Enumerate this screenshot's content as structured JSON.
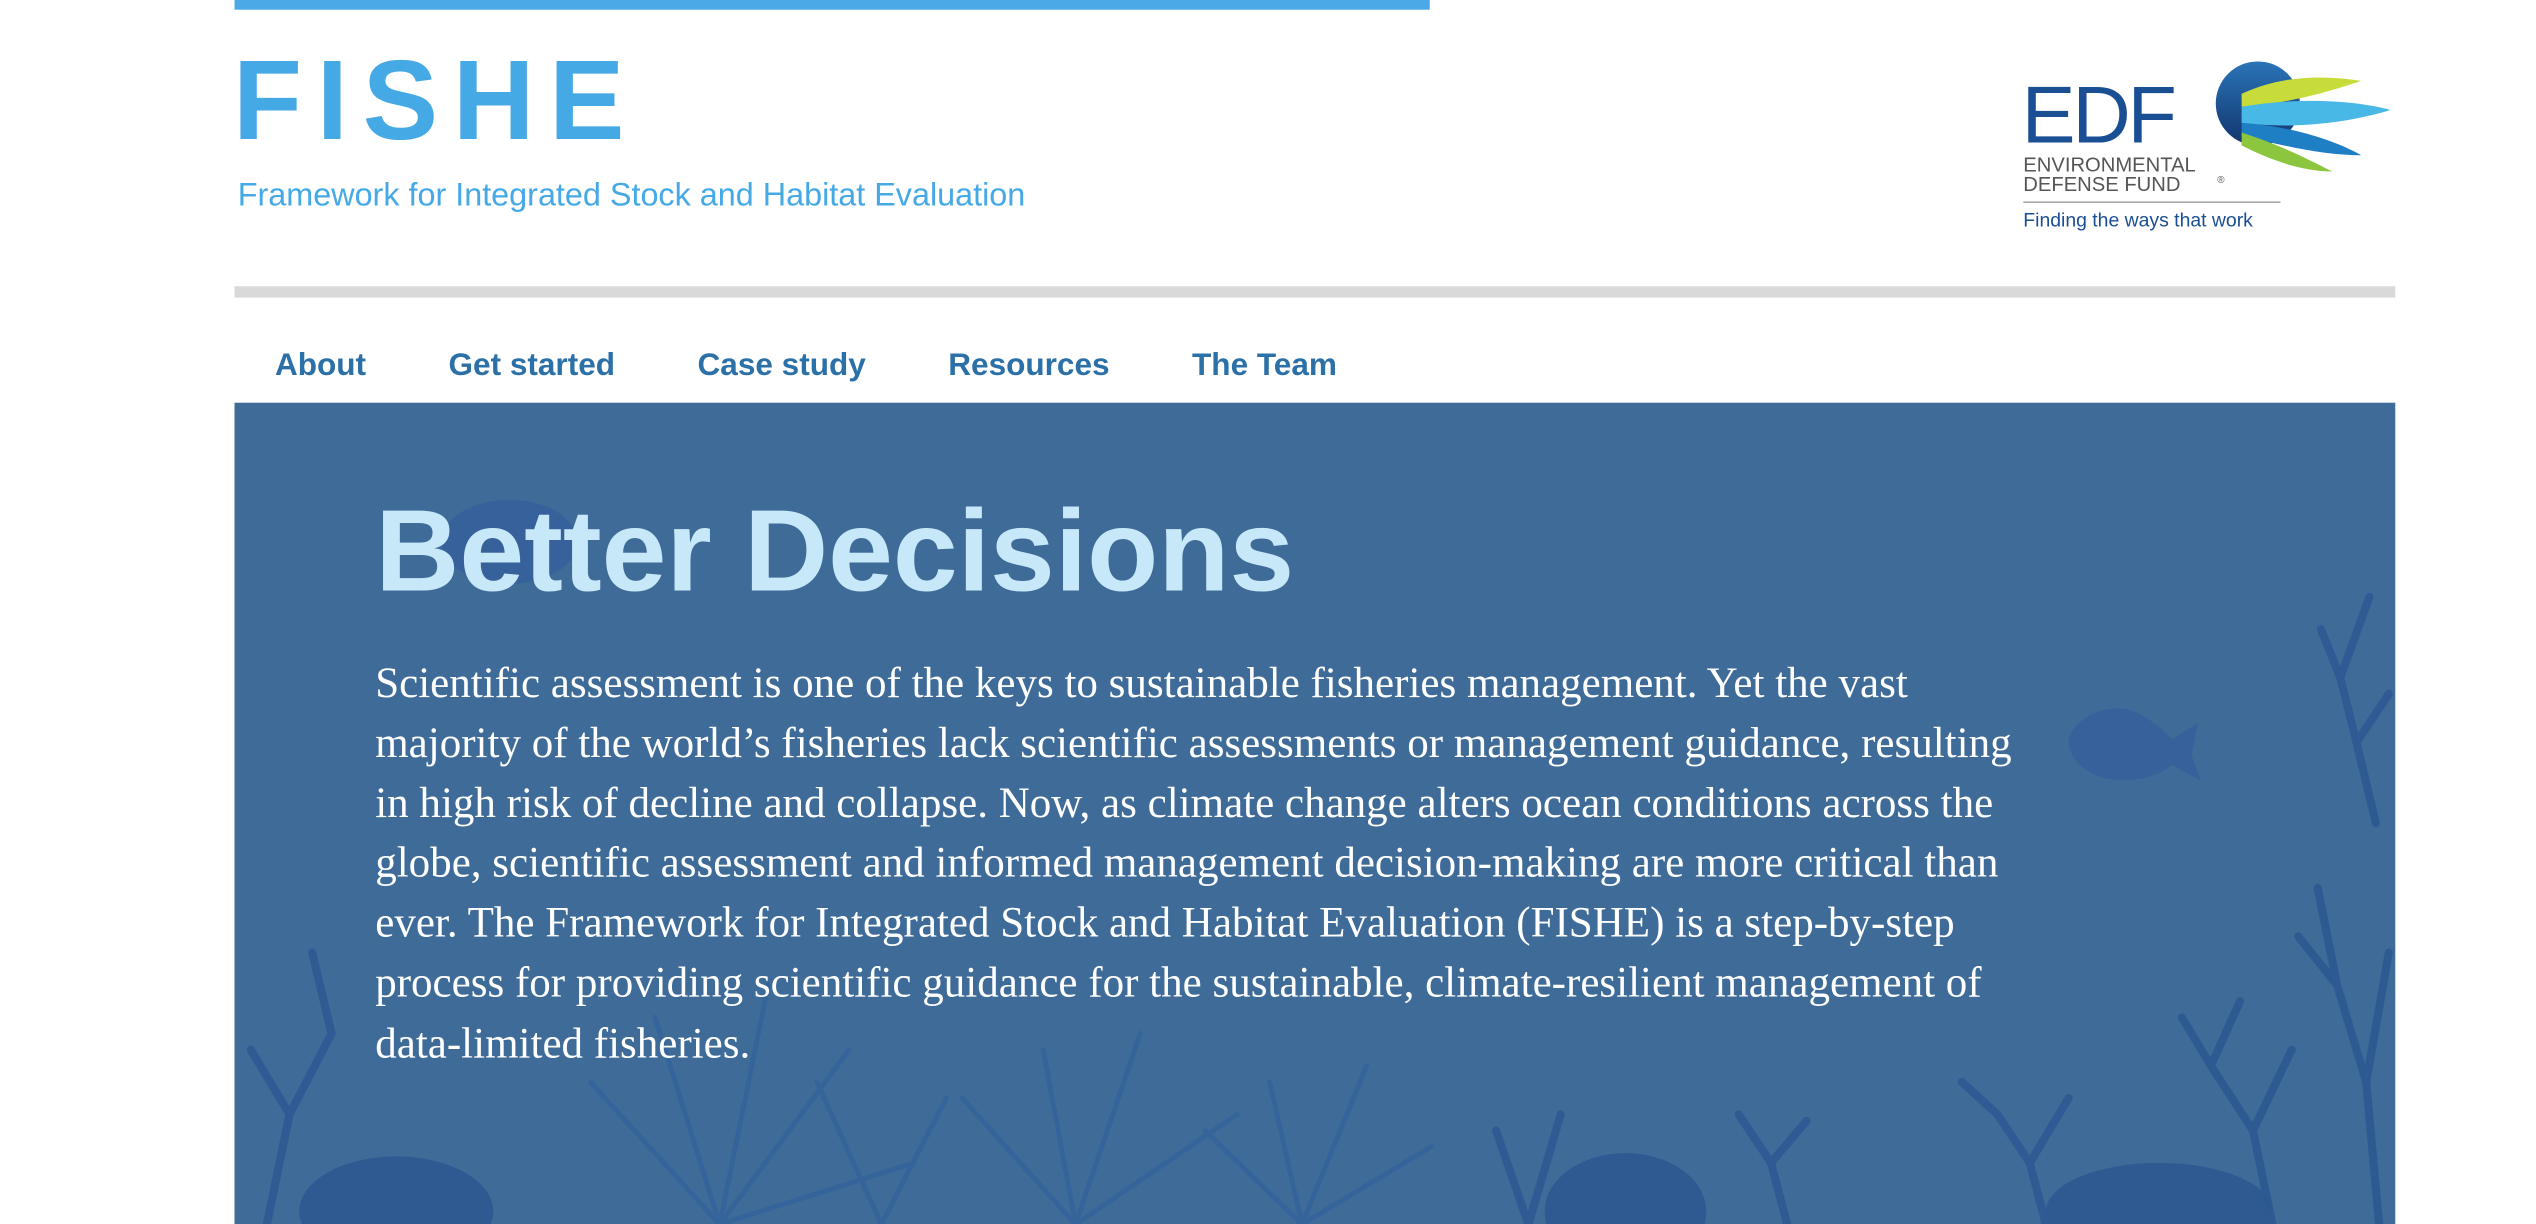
{
  "header": {
    "logo_text": "FISHE",
    "tagline": "Framework for Integrated Stock and Habitat Evaluation",
    "brand_color": "#45a9e6"
  },
  "partner_logo": {
    "name": "EDF",
    "line1": "ENVIRONMENTAL",
    "line2": "DEFENSE FUND",
    "slogan": "Finding the ways that work"
  },
  "nav": {
    "items": [
      {
        "label": "About"
      },
      {
        "label": "Get started"
      },
      {
        "label": "Case study"
      },
      {
        "label": "Resources"
      },
      {
        "label": "The Team"
      }
    ],
    "color": "#2c70a8"
  },
  "hero": {
    "headline": "Better Decisions",
    "body": "Scientific assessment is one of the keys to sustainable fisheries management. Yet the vast majority of the world’s fisheries lack scientific assessments or management guidance, resulting in high risk of decline and collapse. Now, as climate change alters ocean conditions across the globe, scientific assessment and informed management decision-making are more critical than ever. The Framework for Integrated Stock and Habitat Evaluation (FISHE) is a step-by-step process for providing scientific guidance for the sustainable, climate-resilient management of data-limited fisheries.",
    "background_color": "#3e6b98",
    "headline_color": "#c6e8f8"
  }
}
